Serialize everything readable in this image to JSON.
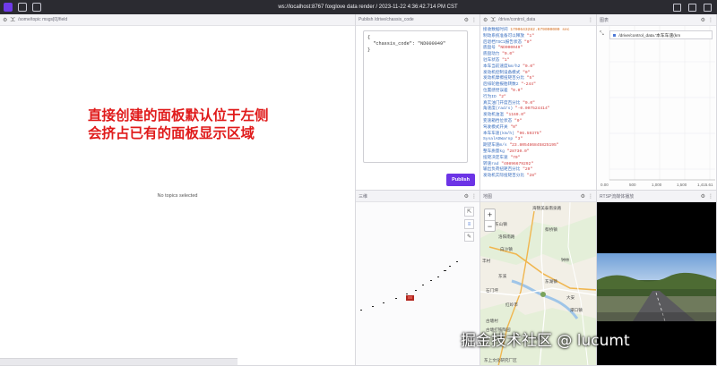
{
  "topbar": {
    "title": "ws://localhost:8767 foxglove data render / 2023-11-22 4:36:42.714 PM CST"
  },
  "panel_image": {
    "topic_placeholder": "/some/topic msgs[0]/field",
    "overlay_line1": "直接创建的面板默认位于左侧",
    "overlay_line2": "会挤占已有的面板显示区域",
    "empty_text": "No topics selected"
  },
  "panel_publish": {
    "title": "Publish /drive/chassis_code",
    "editor_text": "{\n  \"chassis_code\": \"ND000049\"\n}",
    "button_label": "Publish"
  },
  "panel_raw": {
    "topic": "/drive/control_data",
    "rows": [
      {
        "k": "接收数据时间",
        "v": "1700643282.679000000 sec",
        "t": "num"
      },
      {
        "k": "制动系统准备可以释放",
        "v": "1",
        "t": "str"
      },
      {
        "k": "后退档TSC1报告状态",
        "v": "0",
        "t": "str"
      },
      {
        "k": "底盘号",
        "v": "ND000049",
        "t": "str"
      },
      {
        "k": "底盘动力",
        "v": "0.0",
        "t": "str"
      },
      {
        "k": "驻车状态",
        "v": "1",
        "t": "str"
      },
      {
        "k": "本车当前速度km/h2",
        "v": "0.0",
        "t": "str"
      },
      {
        "k": "发动机控制设备模式",
        "v": "0",
        "t": "str"
      },
      {
        "k": "发动机摩擦扭矩百分比",
        "v": "5",
        "t": "str"
      },
      {
        "k": "后排轮胎报胎转数2",
        "v": "-244",
        "t": "str"
      },
      {
        "k": "位置感觉误差",
        "v": "0.0",
        "t": "str"
      },
      {
        "k": "行为ID",
        "v": "2",
        "t": "str"
      },
      {
        "k": "真实油门开度百分比",
        "v": "0.0",
        "t": "str"
      },
      {
        "k": "角速度(rad/s)",
        "v": "-0.007524414",
        "t": "str"
      },
      {
        "k": "发动机油温",
        "v": "1169.0",
        "t": "str"
      },
      {
        "k": "变速箱挡位状态",
        "v": "0",
        "t": "str"
      },
      {
        "k": "驾驶模式开关",
        "v": "0",
        "t": "str"
      },
      {
        "k": "本车车速(km/h)",
        "v": "96.59375",
        "t": "str"
      },
      {
        "k": "SysalADWarnp",
        "v": "3",
        "t": "str"
      },
      {
        "k": "期望车速m/s",
        "v": "23.805486845825195",
        "t": "str"
      },
      {
        "k": "整车质量kg",
        "v": "28730.0",
        "t": "str"
      },
      {
        "k": "扭矩决定车速",
        "v": "70",
        "t": "str"
      },
      {
        "k": "转速rad",
        "v": "40896679292",
        "t": "str"
      },
      {
        "k": "输出负荷扭矩百分比",
        "v": "20",
        "t": "str"
      },
      {
        "k": "发动机实际扭矩百分比",
        "v": "28",
        "t": "str"
      }
    ]
  },
  "panel_plot": {
    "title": "图表",
    "legend": "/drive/control_data.'本车车速(km",
    "x_ticks": [
      "0.00",
      "500",
      "1,000",
      "1,500",
      "1,415.61"
    ]
  },
  "chart_data": {
    "type": "line",
    "title": "",
    "xlabel": "",
    "ylabel": "",
    "x_ticks": [
      "0.00",
      "500",
      "1,000",
      "1,500",
      "1,415.61"
    ],
    "series": [
      {
        "name": "/drive/control_data.'本车车速(km",
        "values": []
      }
    ]
  },
  "panel_3d": {
    "title": "三维"
  },
  "panel_map": {
    "title": "地图",
    "labels": [
      "海锦美泰南泉路",
      "东山镇",
      "洛阳南路",
      "蔡桥镇",
      "白沙镇",
      "丰村",
      "钟林",
      "东溪",
      "东湖镇",
      "石门坪",
      "大安",
      "红岭市",
      "潭口镇",
      "古塘村",
      "古塘打铁陶园",
      "陈家",
      "东上文化研究厂区"
    ]
  },
  "panel_camera": {
    "title": "RTSP流媒体播放"
  },
  "watermark": "掘金技术社区 @ lucumt",
  "colors": {
    "accent": "#6c34e6",
    "overlay_red": "#e01b1b"
  }
}
